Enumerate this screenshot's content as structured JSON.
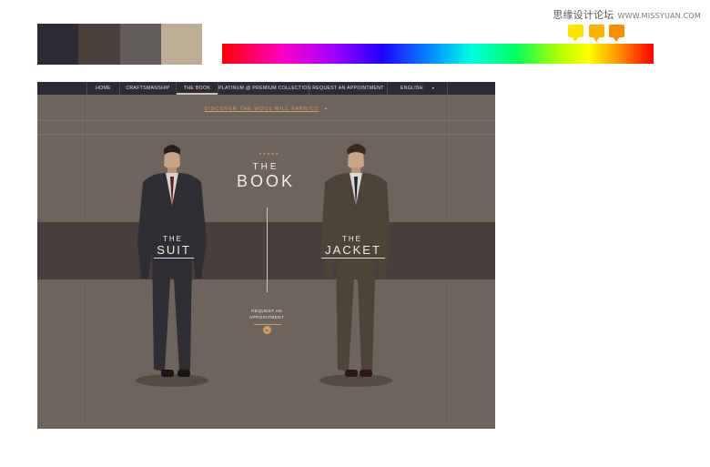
{
  "watermark": {
    "site_name": "思缘设计论坛",
    "url": "WWW.MISSYUAN.COM"
  },
  "palette": {
    "swatches": [
      "#2d2c36",
      "#4a403c",
      "#625d58",
      "#bfac97"
    ]
  },
  "spectrum": {
    "stops": [
      "#ff0000",
      "#ff00c8",
      "#a000ff",
      "#2000ff",
      "#00a0ff",
      "#00ffe0",
      "#00ff60",
      "#b0ff00",
      "#ffff00",
      "#ff9000",
      "#ff0000"
    ],
    "markers": [
      "#f7e600",
      "#f5b400",
      "#f58f00"
    ]
  },
  "site": {
    "nav": {
      "items": [
        "HOME",
        "CRAFTSMANSHIP",
        "THE BOOK",
        "PLATINUM @ PREMIUM COLLECTION",
        "REQUEST AN APPOINTMENT",
        "ENGLISH"
      ],
      "active_index": 2,
      "language_arrow": "▾"
    },
    "discover": {
      "label": "DISCOVER THE WOOL MILL FABRICS",
      "arrow": "+"
    },
    "hero": {
      "stars": "★★★★★",
      "title_small": "THE",
      "title_big": "BOOK",
      "left_the": "THE",
      "left_word": "SUIT",
      "right_the": "THE",
      "right_word": "JACKET",
      "request_line1": "REQUEST AN",
      "request_line2": "APPOINTMENT",
      "request_button": "▸"
    },
    "colors": {
      "background": "#6d645d",
      "navbar": "#2e2c33",
      "band": "#4a3e3c",
      "accent": "#c99c6e",
      "suit_model": "#2f2e33",
      "jacket_model": "#4e4338"
    }
  }
}
